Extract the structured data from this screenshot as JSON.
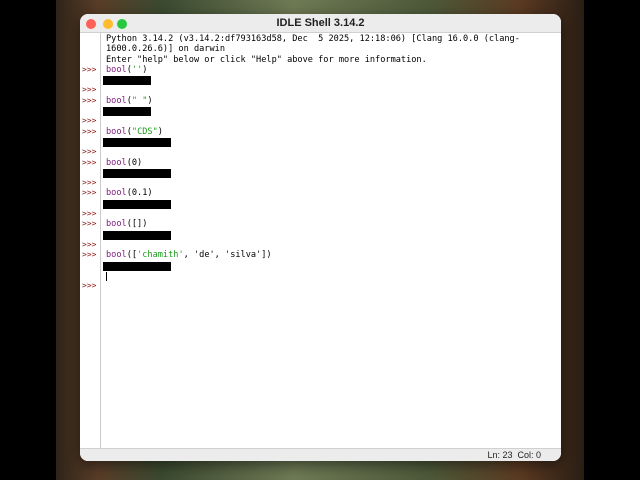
{
  "window": {
    "title": "IDLE Shell 3.14.2"
  },
  "banner": [
    "Python 3.14.2 (v3.14.2:df793163d58, Dec  5 2025, 12:18:06) [Clang 16.0.0 (clang-",
    "1600.0.26.6)] on darwin",
    "Enter \"help\" below or click \"Help\" above for more information."
  ],
  "prompt": ">>>",
  "commands": [
    {
      "fn": "bool",
      "open": "(",
      "arg": "''",
      "close": ")"
    },
    {
      "fn": "bool",
      "open": "(",
      "arg": "\" \"",
      "close": ")"
    },
    {
      "fn": "bool",
      "open": "(",
      "arg": "\"CDS\"",
      "close": ")"
    },
    {
      "fn": "bool",
      "open": "(0)",
      "arg": "",
      "close": ""
    },
    {
      "fn": "bool",
      "open": "(0.1)",
      "arg": "",
      "close": ""
    },
    {
      "fn": "bool",
      "open": "([])",
      "arg": "",
      "close": ""
    },
    {
      "fn": "bool",
      "open": "([",
      "arg": "'chamith'",
      "close": ", 'de', 'silva'])"
    }
  ],
  "status": {
    "line": "Ln: 23",
    "col": "Col: 0"
  }
}
